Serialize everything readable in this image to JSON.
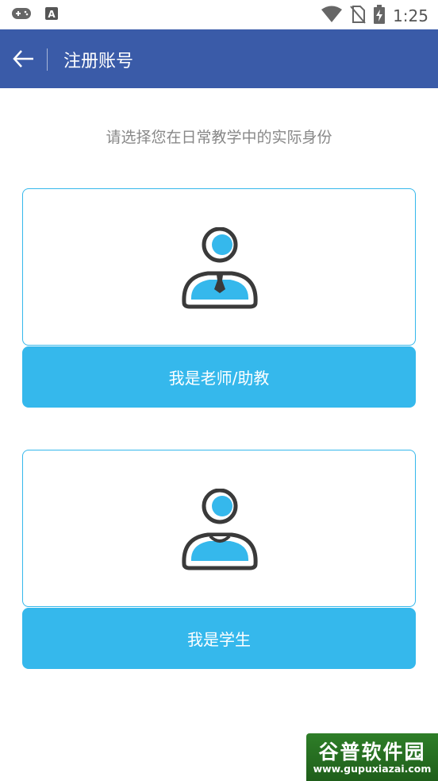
{
  "status_bar": {
    "time": "1:25",
    "icons": [
      "gamepad-icon",
      "text-a-icon",
      "wifi-icon",
      "no-sim-icon",
      "battery-charging-icon"
    ]
  },
  "app_bar": {
    "title": "注册账号",
    "back_icon": "arrow-left-icon",
    "background": "#3a5ba8"
  },
  "instruction": "请选择您在日常教学中的实际身份",
  "roles": [
    {
      "icon": "teacher-avatar-icon",
      "label": "我是老师/助教"
    },
    {
      "icon": "student-avatar-icon",
      "label": "我是学生"
    }
  ],
  "accent_color": "#35b8ec",
  "watermark": {
    "title": "谷普软件园",
    "url": "www.gupuxiazai.com"
  }
}
